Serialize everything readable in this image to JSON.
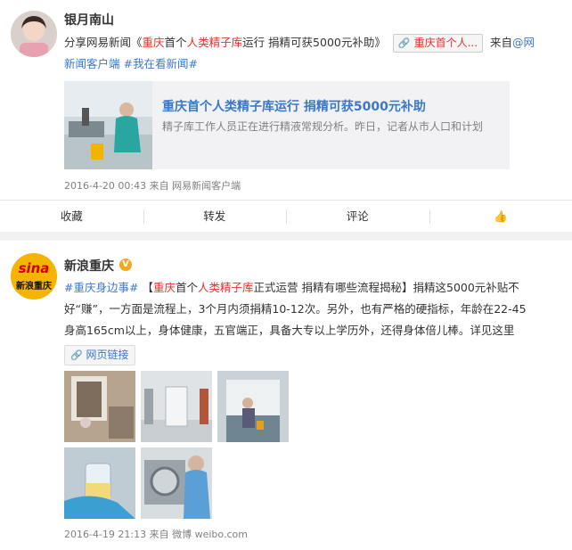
{
  "post1": {
    "user_name": "银月南山",
    "text": {
      "prefix": "分享网易新闻",
      "open_quote": "《",
      "title_parts": [
        "重庆",
        "首个",
        "人类精子库",
        "运行 捐精可获5000元补助",
        "》"
      ],
      "tag_label": "重庆首个人...",
      "via_text": "来自",
      "via_link": "@网",
      "hashtags": [
        "新闻客户端",
        "#我在看新闻#"
      ]
    },
    "card": {
      "title": "重庆首个人类精子库运行 捐精可获5000元补助",
      "description": "精子库工作人员正在进行精液常规分析。昨日，记者从市人口和计划"
    },
    "meta": "2016-4-20 00:43 来自 网易新闻客户端",
    "actions": [
      "收藏",
      "转发",
      "评论",
      "👍"
    ]
  },
  "post2": {
    "user_name": "新浪重庆",
    "verified_mark": "V",
    "avatar_text_top": "sina",
    "avatar_text_bottom": "新浪重庆",
    "text": {
      "hashtag": "#重庆身边事#",
      "bracket_open": "【",
      "headline_parts": [
        "重庆",
        "首个",
        "人类精子库",
        "正式运营 捐精有哪些流程揭秘",
        "】"
      ],
      "body1": "捐精这5000元补贴不",
      "line2": "好“赚”，一方面是流程上，3个月内须捐精10-12次。另外，也有严格的硬指标，年龄在22-45",
      "line3": "身高165cm以上，身体健康，五官端正，具备大专以上学历外，还得身体倍儿棒。详见这里"
    },
    "link_label": "网页链接",
    "meta": "2016-4-19 21:13 来自 微博 weibo.com"
  },
  "colors": {
    "accent_red": "#eb2d2d",
    "link_blue": "#3c78c8",
    "meta_gray": "#808080"
  }
}
